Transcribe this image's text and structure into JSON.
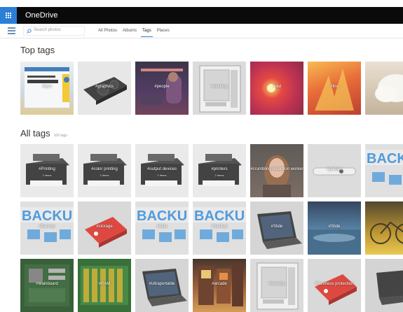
{
  "app": {
    "title": "OneDrive"
  },
  "toolbar": {
    "search_placeholder": "Search photos",
    "tabs": [
      "All Photos",
      "Albums",
      "Tags",
      "Places"
    ],
    "active_tab": "Tags"
  },
  "top_tags": {
    "heading": "Top tags",
    "tiles": [
      {
        "label": "#lync",
        "count": "",
        "scene": "lync"
      },
      {
        "label": "#graphics",
        "count": "",
        "scene": "gpu"
      },
      {
        "label": "#people",
        "count": "",
        "scene": "web"
      },
      {
        "label": "#desktop",
        "count": "",
        "scene": "case"
      },
      {
        "label": "#red",
        "count": "",
        "scene": "red"
      },
      {
        "label": "#fire",
        "count": "",
        "scene": "fire"
      },
      {
        "label": "",
        "count": "",
        "scene": "cloud"
      }
    ]
  },
  "all_tags": {
    "heading": "All tags",
    "count_note": "100 tags",
    "rows": [
      [
        {
          "label": "#Printing",
          "count": "2 items",
          "scene": "printer"
        },
        {
          "label": "#color printing",
          "count": "2 items",
          "scene": "printer"
        },
        {
          "label": "#output devices",
          "count": "2 items",
          "scene": "printer"
        },
        {
          "label": "#printers",
          "count": "2 items",
          "scene": "printer"
        },
        {
          "label": "#crumbling reception worker",
          "count": "",
          "scene": "person"
        },
        {
          "label": "#gadget",
          "count": "",
          "scene": "silver"
        },
        {
          "label": "",
          "count": "",
          "scene": "backup"
        }
      ],
      [
        {
          "label": "#Backup",
          "count": "",
          "scene": "backup"
        },
        {
          "label": "#storage",
          "count": "",
          "scene": "redbutton"
        },
        {
          "label": "#data",
          "count": "",
          "scene": "backup"
        },
        {
          "label": "#backup",
          "count": "",
          "scene": "backup"
        },
        {
          "label": "#Slide",
          "count": "",
          "scene": "laptop"
        },
        {
          "label": "#Slide",
          "count": "",
          "scene": "windows"
        },
        {
          "label": "",
          "count": "",
          "scene": "bike"
        }
      ],
      [
        {
          "label": "#Mainboard",
          "count": "",
          "scene": "board"
        },
        {
          "label": "#RAM",
          "count": "",
          "scene": "ram"
        },
        {
          "label": "#ultraportable",
          "count": "",
          "scene": "laptop"
        },
        {
          "label": "#arcade",
          "count": "",
          "scene": "arcade"
        },
        {
          "label": "#desktop",
          "count": "",
          "scene": "case"
        },
        {
          "label": "#business protection",
          "count": "",
          "scene": "redbutton"
        },
        {
          "label": "",
          "count": "",
          "scene": "dark"
        }
      ]
    ]
  }
}
